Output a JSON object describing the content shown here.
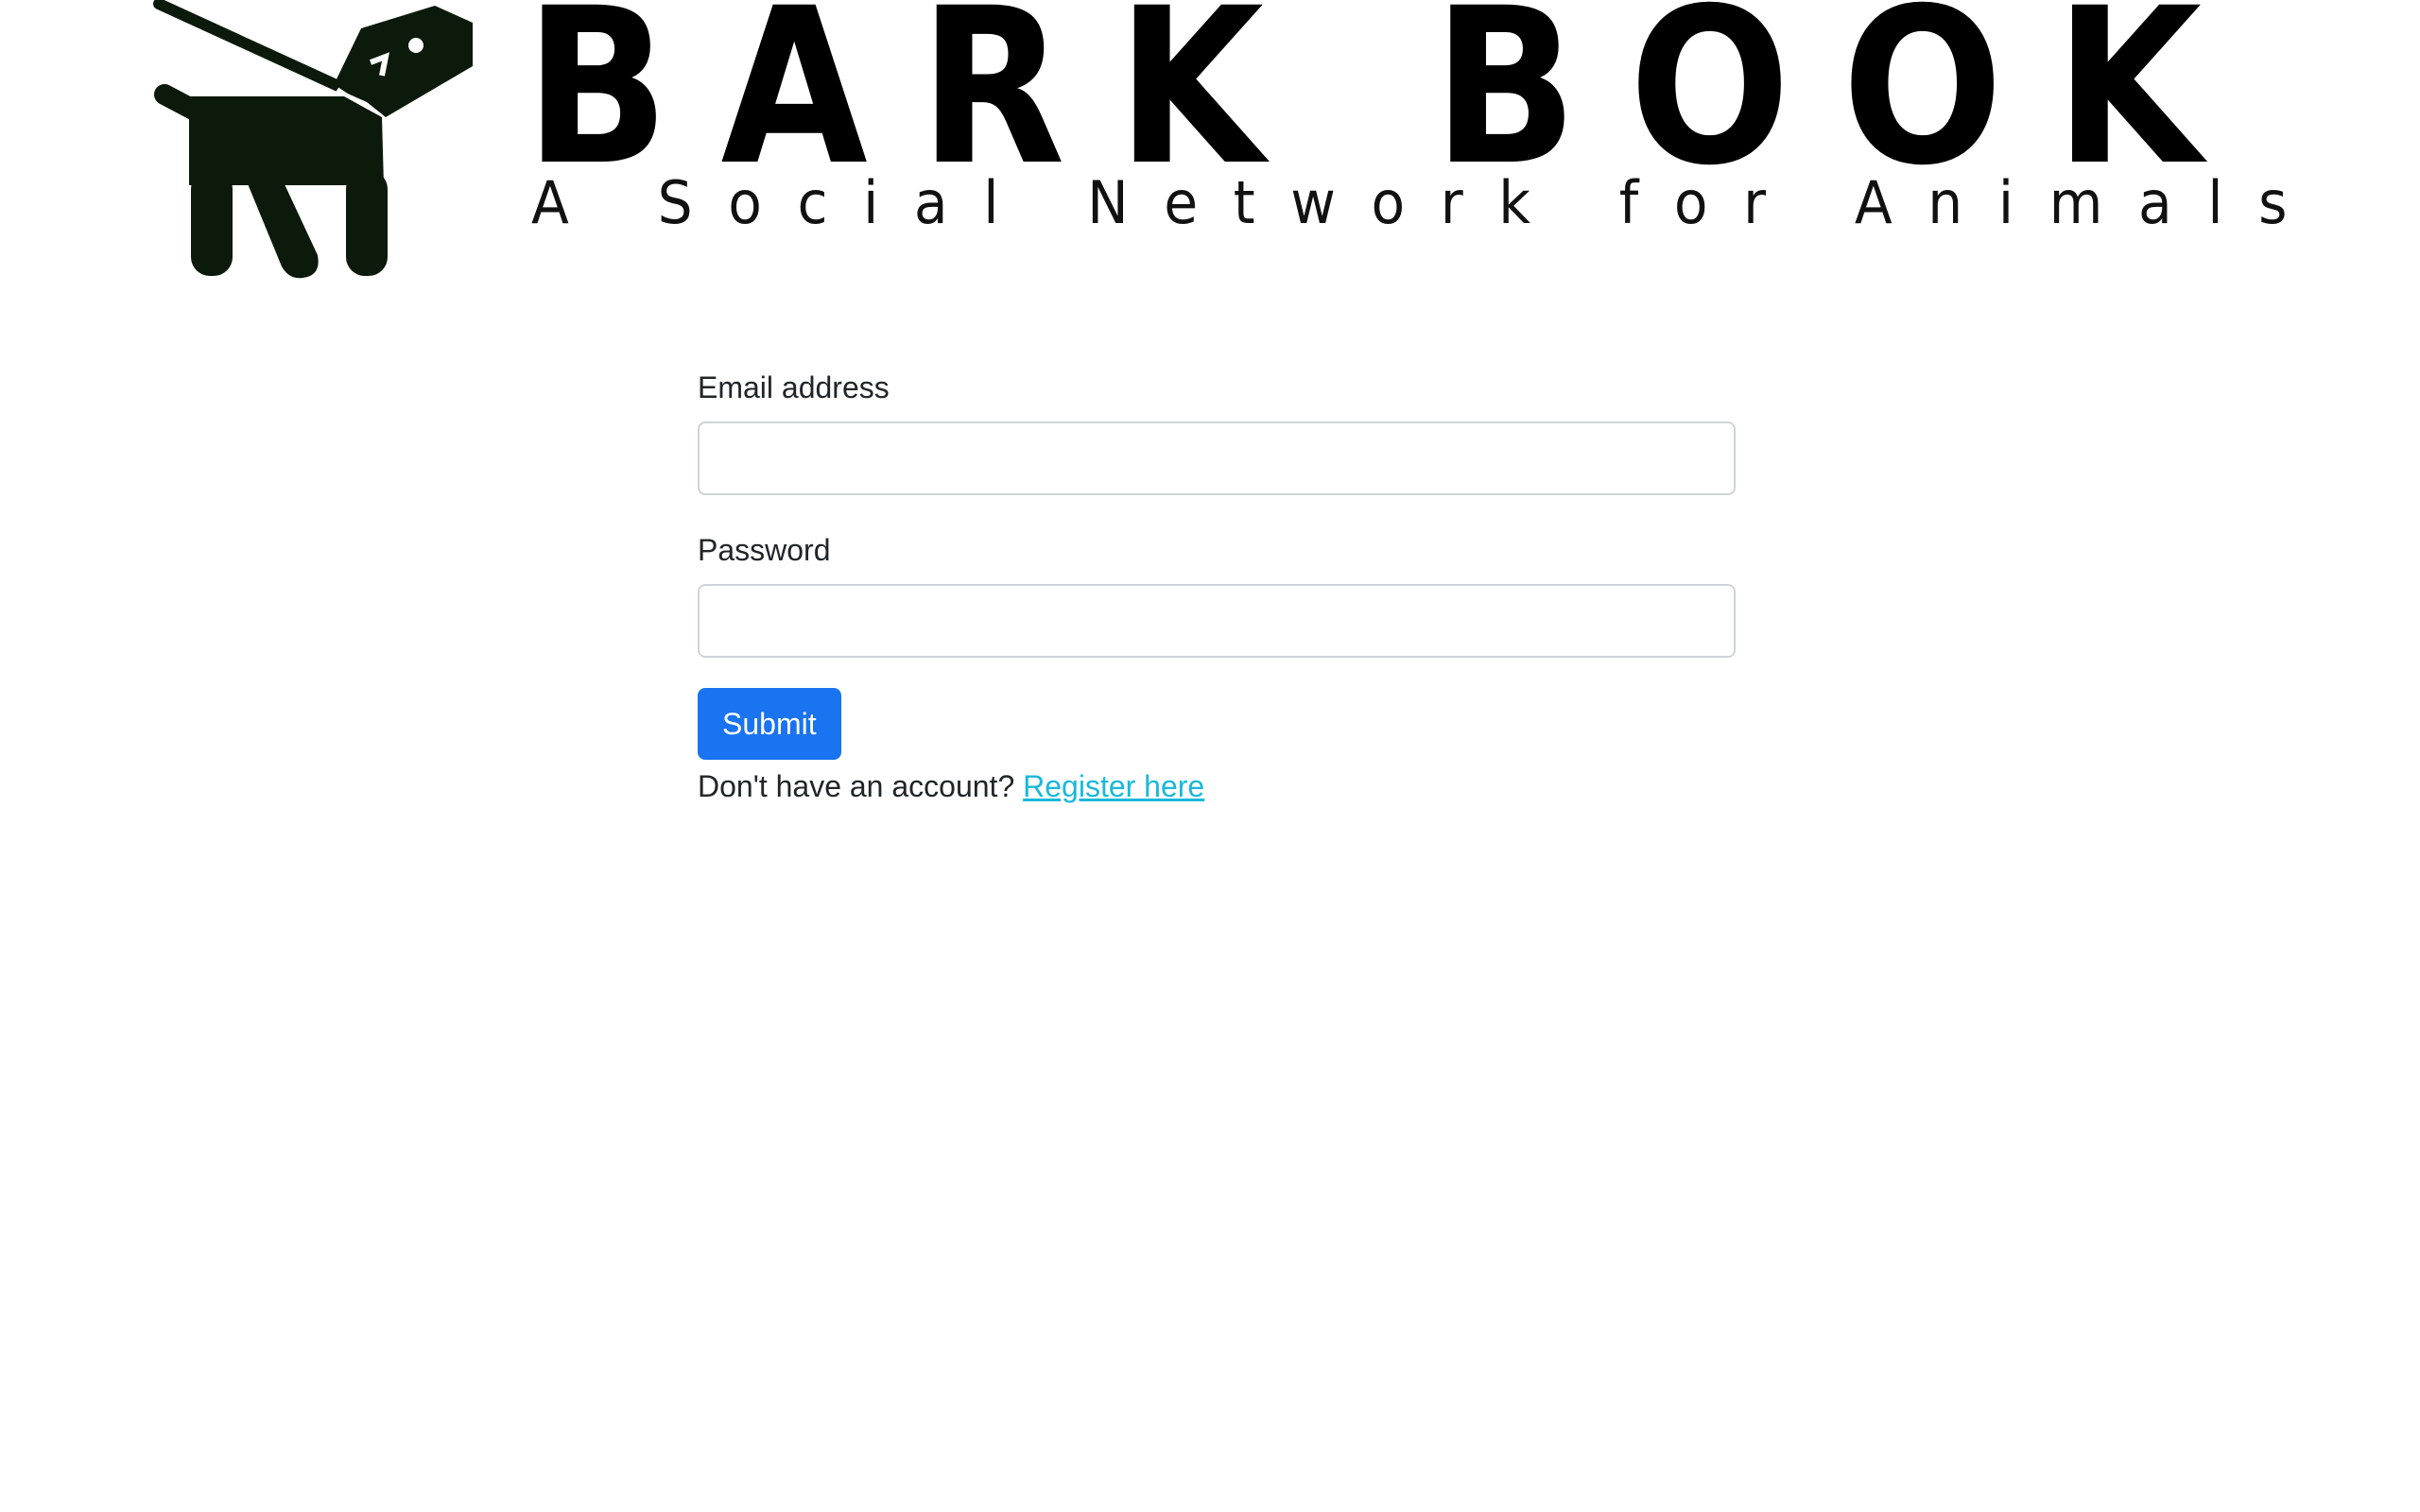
{
  "brand": {
    "title": "BARK BOOK",
    "tagline": "A Social Network for Animals",
    "logo_icon": "dog-on-leash-icon"
  },
  "login_form": {
    "email_label": "Email address",
    "email_value": "",
    "password_label": "Password",
    "password_value": "",
    "submit_label": "Submit",
    "register_prompt": "Don't have an account?",
    "register_link": "Register here"
  },
  "colors": {
    "primary_button": "#1a73f0",
    "link": "#1ab8da",
    "text": "#212529",
    "input_border": "#ced4da"
  }
}
